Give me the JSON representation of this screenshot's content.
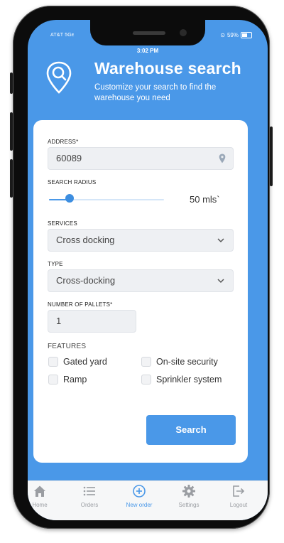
{
  "status_bar": {
    "carrier": "AT&T  5Gᴇ",
    "battery": "59%",
    "time": "3:02 PM"
  },
  "header": {
    "title": "Warehouse search",
    "subtitle": "Customize your search to find the warehouse you need"
  },
  "form": {
    "address": {
      "label": "ADDRESS*",
      "value": "60089"
    },
    "radius": {
      "label": "SEARCH RADIUS",
      "value_text": "50 mls`",
      "fraction": 0.18
    },
    "services": {
      "label": "SERVICES",
      "selected": "Cross docking"
    },
    "type": {
      "label": "TYPE",
      "selected": "Cross-docking"
    },
    "pallets": {
      "label": "NUMBER OF PALLETS*",
      "value": "1"
    },
    "features": {
      "label": "FEATURES",
      "options": [
        "Gated yard",
        "On-site security",
        "Ramp",
        "Sprinkler system"
      ]
    },
    "search_label": "Search"
  },
  "tabs": [
    {
      "label": "Home",
      "icon": "home-icon",
      "active": false
    },
    {
      "label": "Orders",
      "icon": "list-icon",
      "active": false
    },
    {
      "label": "New order",
      "icon": "plus-circle-icon",
      "active": true
    },
    {
      "label": "Settings",
      "icon": "gear-icon",
      "active": false
    },
    {
      "label": "Logout",
      "icon": "logout-icon",
      "active": false
    }
  ],
  "colors": {
    "primary": "#4a98e8",
    "background": "#ffffff"
  }
}
